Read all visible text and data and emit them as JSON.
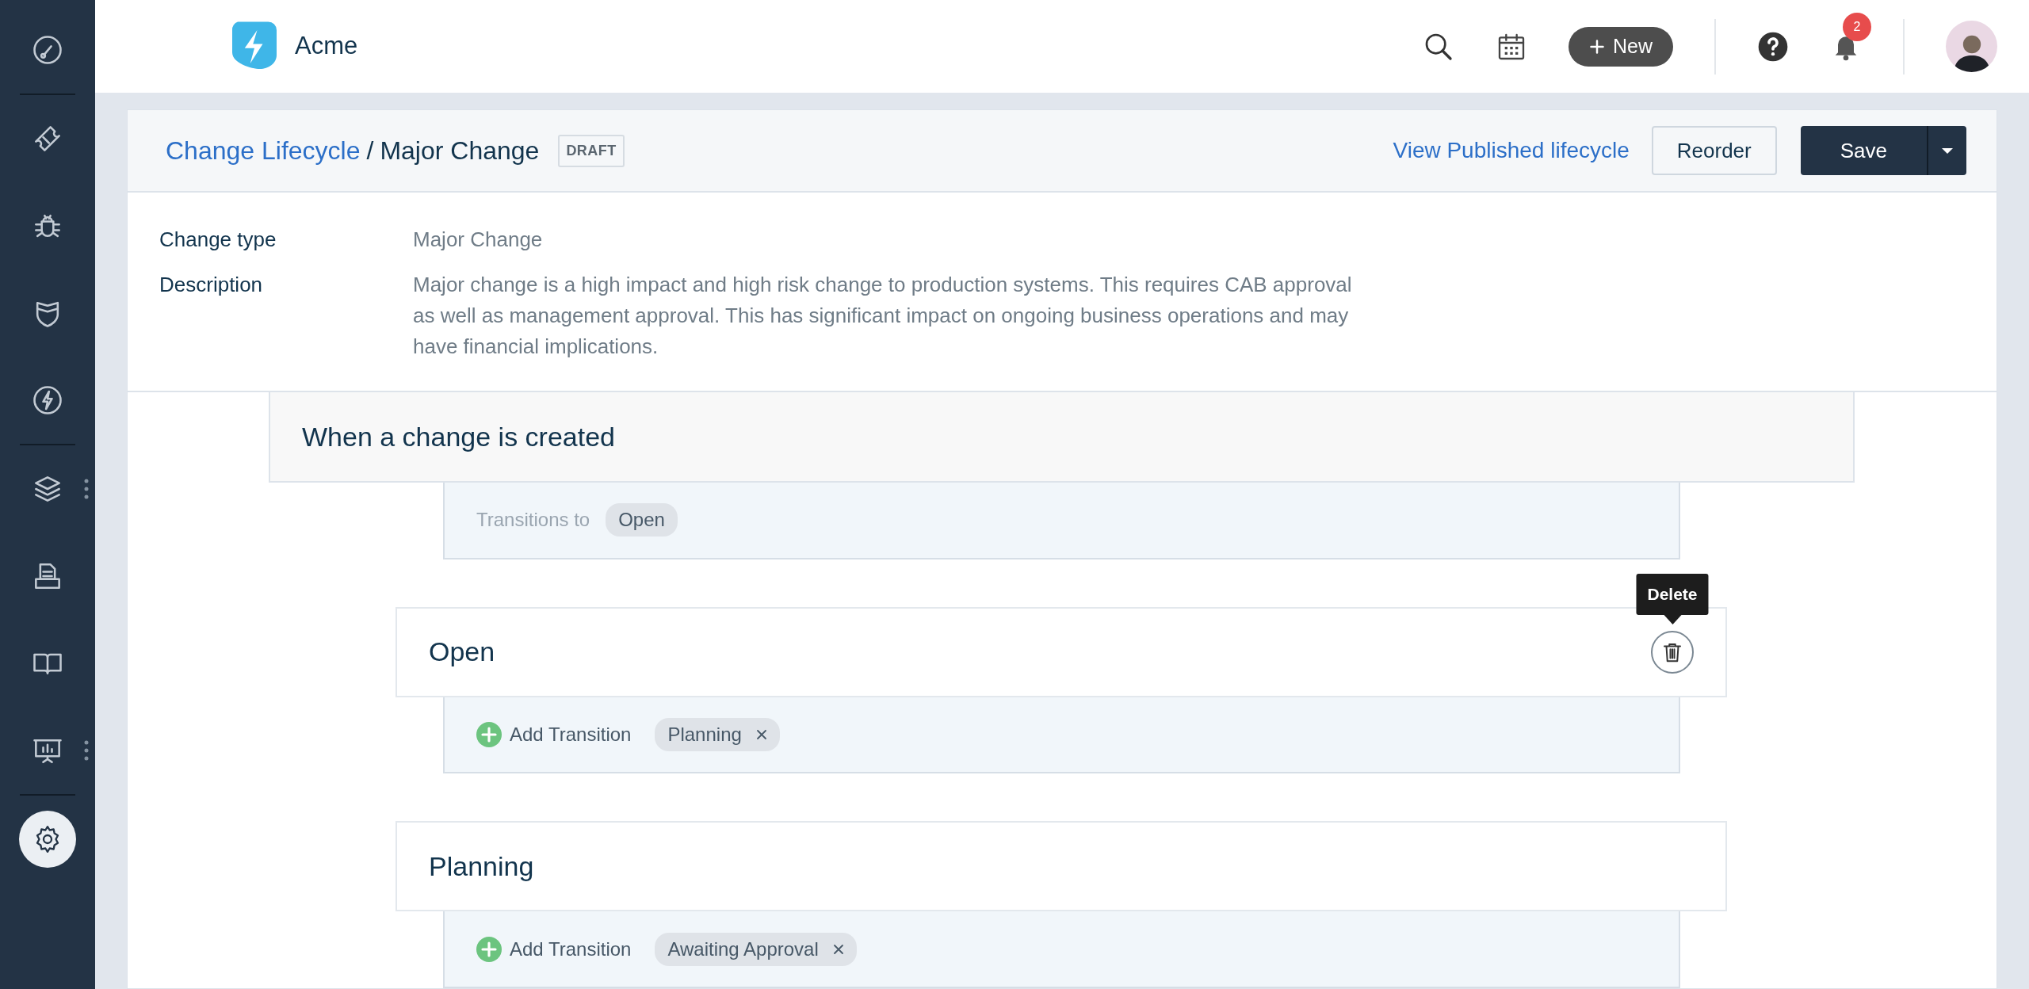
{
  "sidebar": {
    "items": [
      {
        "kind": "dashboard",
        "selected": false,
        "more": false,
        "divider_after": true
      },
      {
        "kind": "ticket",
        "selected": false,
        "more": false,
        "divider_after": false
      },
      {
        "kind": "bug",
        "selected": false,
        "more": false,
        "divider_after": false
      },
      {
        "kind": "shield",
        "selected": false,
        "more": false,
        "divider_after": false
      },
      {
        "kind": "bolt",
        "selected": false,
        "more": false,
        "divider_after": true
      },
      {
        "kind": "layers",
        "selected": false,
        "more": true,
        "divider_after": false
      },
      {
        "kind": "inbox",
        "selected": false,
        "more": false,
        "divider_after": false
      },
      {
        "kind": "book",
        "selected": false,
        "more": false,
        "divider_after": false
      },
      {
        "kind": "presentation",
        "selected": false,
        "more": true,
        "divider_after": true
      },
      {
        "kind": "settings",
        "selected": true,
        "more": false,
        "divider_after": false
      }
    ]
  },
  "header": {
    "app_name": "Acme",
    "new_button": "New",
    "notification_count": "2"
  },
  "page": {
    "breadcrumb": "Change Lifecycle",
    "separator": "/",
    "title": "Major Change",
    "status": "DRAFT",
    "published_link": "View Published lifecycle",
    "reorder_button": "Reorder",
    "save_button": "Save"
  },
  "details": [
    {
      "label": "Change type",
      "value": "Major Change"
    },
    {
      "label": "Description",
      "value": "Major change is a high impact and high risk change to production systems. This requires CAB approval as well as management approval. This has significant impact on ongoing business operations and may have financial implications."
    }
  ],
  "trigger": {
    "title": "When a change is created",
    "transitions_label": "Transitions to",
    "transitions": [
      "Open"
    ]
  },
  "states": [
    {
      "name": "Open",
      "hovered": true,
      "delete_tooltip": "Delete",
      "add_label": "Add Transition",
      "transitions": [
        "Planning"
      ]
    },
    {
      "name": "Planning",
      "hovered": false,
      "add_label": "Add Transition",
      "transitions": [
        "Awaiting Approval"
      ]
    }
  ]
}
